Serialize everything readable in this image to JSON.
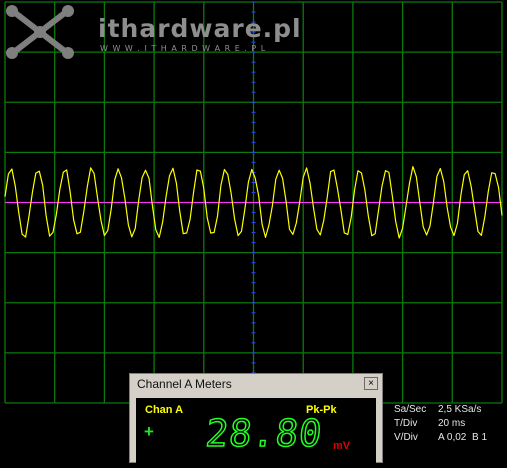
{
  "watermark": {
    "title": "ITHARDWARE.PL",
    "url": "W W W . I T H A R D W A R E . P L"
  },
  "colors": {
    "background": "#000000",
    "grid": "#0b7a0b",
    "axis": "#2a44ff",
    "trace": "#ffff00",
    "trigger_line": "#ff33ff",
    "watermark": "#8e8e8e",
    "readout_digits": "#22ff22",
    "readout_unit": "#e00000"
  },
  "chart_data": {
    "type": "line",
    "grid": true,
    "grid_divisions": {
      "x": 10,
      "y": 8
    },
    "series": [
      {
        "y": [
          0.12,
          0.82,
          1.0,
          0.53,
          -0.32,
          -0.93,
          -0.98,
          -0.45,
          0.28,
          0.88,
          0.97,
          0.47,
          -0.38,
          -0.95,
          -0.93,
          -0.36,
          0.4,
          0.94,
          0.92,
          0.32,
          -0.47,
          -0.97,
          -0.89,
          -0.25,
          0.52,
          0.98,
          0.85,
          0.18,
          -0.58,
          -0.99,
          -0.8,
          -0.12,
          0.63,
          0.99,
          0.76,
          0.04,
          -0.68,
          -0.99,
          -0.71,
          0.03,
          0.73,
          0.98,
          0.66,
          -0.11,
          -0.78,
          -0.97,
          -0.6,
          0.18,
          0.82,
          0.95,
          0.55,
          -0.25,
          -0.86,
          -0.93,
          -0.49,
          0.32,
          0.9,
          0.9,
          0.43,
          -0.39,
          -0.93,
          -0.88,
          -0.37,
          0.45,
          0.95,
          0.84,
          0.31,
          -0.52,
          -0.97,
          -0.81,
          -0.24,
          0.58,
          0.99,
          0.77,
          0.18,
          -0.64,
          -0.99,
          -0.72,
          -0.11,
          0.7,
          1.0,
          0.67,
          0.03,
          -0.75,
          -0.99,
          -0.62,
          0.05,
          0.79,
          0.98,
          0.56,
          -0.12,
          -0.84,
          -0.97,
          -0.5,
          0.2,
          0.87,
          0.95,
          0.44,
          -0.27,
          -0.91,
          -0.92,
          -0.38,
          0.34,
          0.93,
          0.9,
          0.31,
          -0.41,
          -0.96,
          -0.86,
          -0.25,
          0.48,
          0.97,
          0.83,
          0.18,
          -0.54,
          -0.99,
          -0.79,
          -0.11,
          0.6,
          1.0,
          0.74,
          0.04,
          -0.66,
          -0.99,
          -0.69,
          0.03,
          0.71,
          0.98,
          0.64,
          -0.1,
          -0.76,
          -0.97,
          -0.58,
          0.17,
          0.8,
          0.95,
          0.52,
          -0.24,
          -0.85,
          -0.93,
          -0.46,
          0.31,
          0.89,
          0.9,
          0.4,
          -0.38
        ]
      }
    ],
    "trigger_level": 0
  },
  "meters": {
    "window_title": "Channel A Meters",
    "close_label": "×",
    "channel": "Chan A",
    "measurement": "Pk-Pk",
    "add_label": "+",
    "value": "28.80",
    "unit": "mV"
  },
  "info": [
    {
      "key": "Sa/Sec",
      "v1": "2,5 KSa/s",
      "v2": ""
    },
    {
      "key": "T/Div",
      "v1": "20 ms",
      "v2": ""
    },
    {
      "key": "V/Div",
      "v1": "A 0,02",
      "v2": "B 1"
    }
  ]
}
